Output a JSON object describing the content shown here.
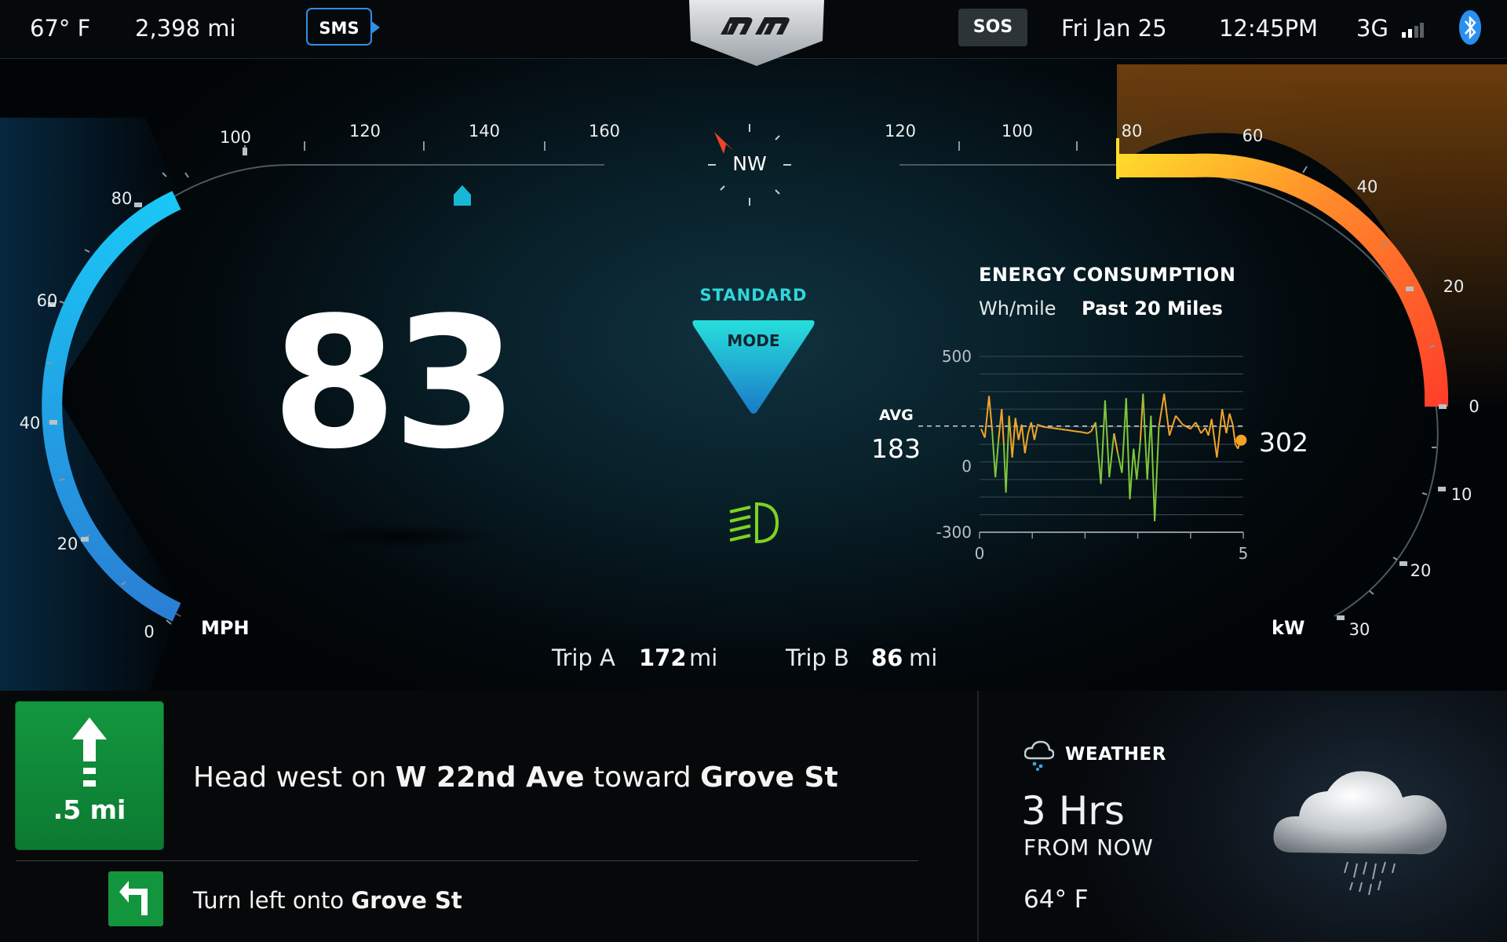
{
  "topbar": {
    "temperature": "67° F",
    "odometer": "2,398 mi",
    "sms_label": "SMS",
    "sos_label": "SOS",
    "date": "Fri Jan 25",
    "time": "12:45PM",
    "network": "3G",
    "icons": {
      "logo": "brand-logo-icon",
      "bluetooth": "bluetooth-icon",
      "signal": "signal-bars-icon"
    }
  },
  "speedometer": {
    "speed": "83",
    "unit": "MPH",
    "ticks": [
      "0",
      "20",
      "40",
      "60",
      "80",
      "100",
      "120",
      "140",
      "160"
    ],
    "max": 160,
    "color": "#2ec8f0"
  },
  "compass": {
    "heading": "NW"
  },
  "drive_mode": {
    "name": "STANDARD",
    "label": "MODE",
    "icon": "mode-triangle-icon"
  },
  "headlights": {
    "icon": "low-beam-headlight-icon",
    "color": "#7ed321"
  },
  "power_gauge": {
    "unit": "kW",
    "power_ticks": [
      "0",
      "20",
      "40",
      "60",
      "80",
      "100",
      "120"
    ],
    "regen_ticks": [
      "10",
      "20",
      "30"
    ],
    "power_level": 80,
    "power_max": 120,
    "colors": {
      "start": "#ffe027",
      "end": "#ff4a2a"
    }
  },
  "energy": {
    "title": "ENERGY CONSUMPTION",
    "unit_label": "Wh/mile",
    "range_label": "Past 20 Miles",
    "avg_label": "AVG",
    "avg_value": "183",
    "current_value": "302"
  },
  "trip": {
    "a_label": "Trip A",
    "a_value": "172",
    "a_unit": "mi",
    "b_label": "Trip B",
    "b_value": "86",
    "b_unit": "mi"
  },
  "navigation": {
    "main": {
      "distance": ".5 mi",
      "verb": "Head west on",
      "road": "W 22nd Ave",
      "connector": "toward",
      "cross": "Grove St",
      "icon": "straight-arrow-icon"
    },
    "next": {
      "verb": "Turn left onto",
      "road": "Grove St",
      "icon": "turn-left-arrow-icon"
    }
  },
  "weather": {
    "title": "WEATHER",
    "forecast": "3 Hrs",
    "when": "FROM NOW",
    "temperature": "64° F",
    "icon": "rain-cloud-icon",
    "small_icon": "cloud-rain-small-icon"
  },
  "chart_data": {
    "type": "line",
    "title": "ENERGY CONSUMPTION",
    "subtitle": "Wh/mile  Past 20 Miles",
    "xlabel": "",
    "ylabel": "",
    "xlim": [
      0,
      5
    ],
    "ylim": [
      -300,
      500
    ],
    "x_ticks": [
      "0",
      "5"
    ],
    "y_ticks": [
      "500",
      "0",
      "-300"
    ],
    "avg": 183,
    "current": 302,
    "grid": true,
    "series": [
      {
        "x": [
          0.03,
          0.1,
          0.18,
          0.24,
          0.3,
          0.36,
          0.42,
          0.46,
          0.5,
          0.56,
          0.62,
          0.68,
          0.74,
          0.8,
          0.86,
          0.92,
          0.98,
          1.04,
          1.1,
          1.2,
          1.35,
          1.5,
          1.65,
          1.8,
          1.95,
          2.05,
          2.12,
          2.2,
          2.3,
          2.38,
          2.46,
          2.55,
          2.62,
          2.7,
          2.78,
          2.85,
          2.92,
          2.98,
          3.05,
          3.1,
          3.18,
          3.25,
          3.32,
          3.4,
          3.5,
          3.6,
          3.72,
          3.85,
          4.0,
          4.1,
          4.2,
          4.28,
          4.34,
          4.4,
          4.5,
          4.6,
          4.68,
          4.74,
          4.8,
          4.85,
          4.9,
          4.96
        ],
        "y": [
          170,
          130,
          320,
          160,
          -50,
          120,
          260,
          100,
          -120,
          230,
          40,
          220,
          120,
          190,
          60,
          150,
          200,
          120,
          190,
          180,
          175,
          170,
          165,
          160,
          155,
          150,
          160,
          200,
          -80,
          300,
          -50,
          150,
          60,
          -30,
          310,
          -150,
          80,
          -60,
          120,
          330,
          -60,
          230,
          -250,
          180,
          330,
          140,
          230,
          190,
          170,
          200,
          150,
          175,
          140,
          215,
          40,
          260,
          150,
          240,
          190,
          100,
          80,
          135
        ]
      }
    ],
    "colors": {
      "positive": "#f2a429",
      "negative": "#7fc73a",
      "current_marker": "#f7a124"
    }
  }
}
